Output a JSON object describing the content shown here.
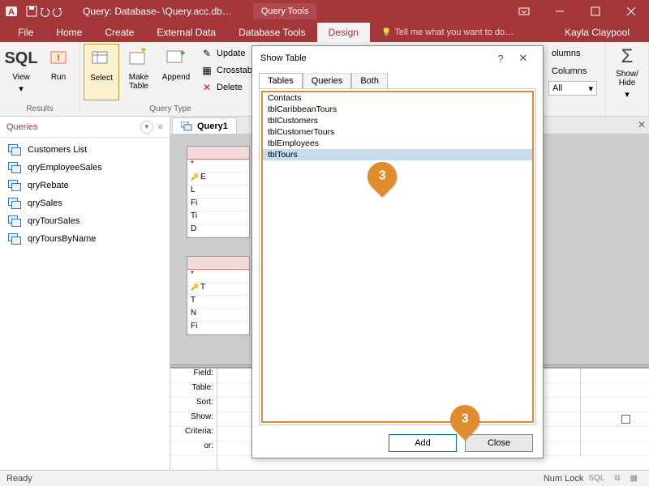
{
  "titlebar": {
    "title": "Query: Database- \\Query.acc.db…",
    "context": "Query Tools"
  },
  "tabs": {
    "file": "File",
    "home": "Home",
    "create": "Create",
    "external": "External Data",
    "dbtools": "Database Tools",
    "design": "Design",
    "tell": "Tell me what you want to do…",
    "user": "Kayla Claypool"
  },
  "ribbon": {
    "sql": "SQL",
    "view": "View",
    "run": "Run",
    "select": "Select",
    "maketable": "Make Table",
    "append": "Append",
    "update": "Update",
    "crosstab": "Crosstab",
    "delete": "Delete",
    "columns": "olumns",
    "columns2": "Columns",
    "all": "All",
    "sigma": "Σ",
    "showhide": "Show/\nHide",
    "grp_results": "Results",
    "grp_qtype": "Query Type"
  },
  "nav": {
    "header": "Queries",
    "items": [
      "Customers List",
      "qryEmployeeSales",
      "qryRebate",
      "qrySales",
      "qryTourSales",
      "qryToursByName"
    ]
  },
  "doc": {
    "tab": "Query1"
  },
  "tablecards": [
    {
      "rows": [
        "*",
        "E",
        "L",
        "Fi",
        "Ti",
        "D"
      ],
      "pk": 1
    },
    {
      "rows": [
        "*",
        "T",
        "T",
        "N",
        "Fi"
      ],
      "pk": 1
    }
  ],
  "qbe": {
    "labels": [
      "Field:",
      "Table:",
      "Sort:",
      "Show:",
      "Criteria:",
      "or:"
    ]
  },
  "dialog": {
    "title": "Show Table",
    "help": "?",
    "close": "✕",
    "tabs": [
      "Tables",
      "Queries",
      "Both"
    ],
    "items": [
      "Contacts",
      "tblCaribbeanTours",
      "tblCustomers",
      "tblCustomerTours",
      "tblEmployees",
      "tblTours"
    ],
    "selected": 5,
    "add": "Add",
    "closeBtn": "Close"
  },
  "callouts": {
    "a": "3",
    "b": "3"
  },
  "status": {
    "ready": "Ready",
    "numlock": "Num Lock",
    "sql": "SQL"
  }
}
